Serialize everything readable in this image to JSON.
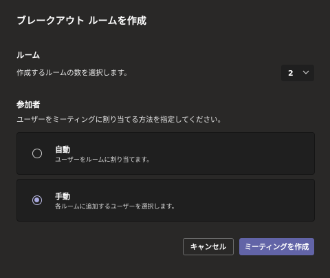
{
  "dialog": {
    "title": "ブレークアウト ルームを作成"
  },
  "rooms": {
    "heading": "ルーム",
    "description": "作成するルームの数を選択します。",
    "selected_count": "2"
  },
  "participants": {
    "heading": "参加者",
    "description": "ユーザーをミーティングに割り当てる方法を指定してください。",
    "options": [
      {
        "title": "自動",
        "description": "ユーザーをルームに割り当てます。",
        "checked": false
      },
      {
        "title": "手動",
        "description": "各ルームに追加するユーザーを選択します。",
        "checked": true
      }
    ]
  },
  "buttons": {
    "cancel": "キャンセル",
    "create": "ミーティングを作成"
  },
  "colors": {
    "accent": "#6264a7",
    "background": "#292827",
    "card": "#1f1f1f"
  },
  "icons": {
    "dropdown": "chevron-down-icon"
  }
}
